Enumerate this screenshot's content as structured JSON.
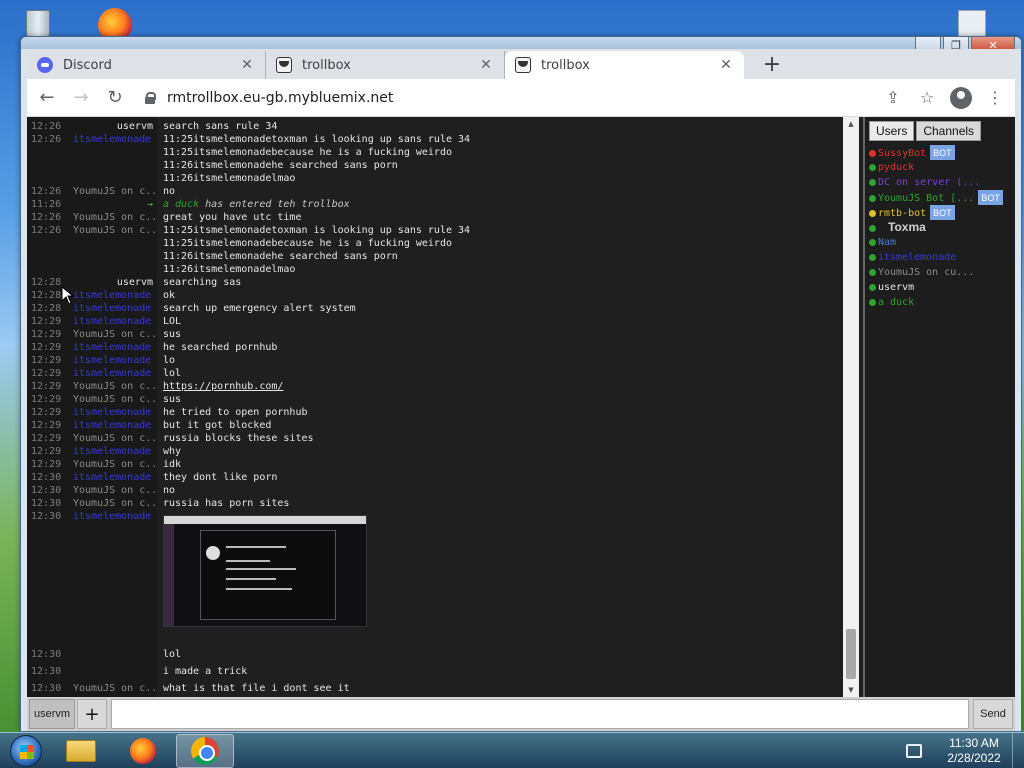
{
  "tabs": [
    {
      "title": "Discord",
      "icon": "discord-icon"
    },
    {
      "title": "trollbox",
      "icon": "troll-icon"
    },
    {
      "title": "trollbox",
      "icon": "troll-icon"
    }
  ],
  "url": "rmtrollbox.eu-gb.mybluemix.net",
  "chat": [
    {
      "time": "12:26",
      "nick": "uservm",
      "nick_class": "user",
      "text": "search sans rule 34"
    },
    {
      "time": "12:26",
      "nick": "itsmelemonade",
      "nick_class": "lemon",
      "text": "11:25itsmelemonadetoxman is looking up sans rule 34"
    },
    {
      "time": "",
      "nick": "",
      "nick_class": "",
      "text": "11:25itsmelemonadebecause he is a fucking weirdo"
    },
    {
      "time": "",
      "nick": "",
      "nick_class": "",
      "text": "11:26itsmelemonadehe searched sans porn"
    },
    {
      "time": "",
      "nick": "",
      "nick_class": "",
      "text": "11:26itsmelemonadelmao"
    },
    {
      "time": "12:26",
      "nick": "YoumuJS on c...",
      "nick_class": "youmu",
      "text": "no"
    },
    {
      "time": "11:26",
      "nick": "→",
      "nick_class": "arrow",
      "text": "",
      "system_who": "a duck",
      "system_text": " has entered teh trollbox"
    },
    {
      "time": "12:26",
      "nick": "YoumuJS on c...",
      "nick_class": "youmu",
      "text": "great you have utc time"
    },
    {
      "time": "12:26",
      "nick": "YoumuJS on c...",
      "nick_class": "youmu",
      "text": "11:25itsmelemonadetoxman is looking up sans rule 34"
    },
    {
      "time": "",
      "nick": "",
      "nick_class": "",
      "text": "11:25itsmelemonadebecause he is a fucking weirdo"
    },
    {
      "time": "",
      "nick": "",
      "nick_class": "",
      "text": "11:26itsmelemonadehe searched sans porn"
    },
    {
      "time": "",
      "nick": "",
      "nick_class": "",
      "text": "11:26itsmelemonadelmao"
    },
    {
      "time": "12:28",
      "nick": "uservm",
      "nick_class": "user",
      "text": "searching sas"
    },
    {
      "time": "12:28",
      "nick": "itsmelemonade",
      "nick_class": "lemon",
      "text": "ok"
    },
    {
      "time": "12:28",
      "nick": "itsmelemonade",
      "nick_class": "lemon",
      "text": "search up emergency alert system"
    },
    {
      "time": "12:29",
      "nick": "itsmelemonade",
      "nick_class": "lemon",
      "text": "LOL"
    },
    {
      "time": "12:29",
      "nick": "YoumuJS on c...",
      "nick_class": "youmu",
      "text": "sus"
    },
    {
      "time": "12:29",
      "nick": "itsmelemonade",
      "nick_class": "lemon",
      "text": "he searched pornhub"
    },
    {
      "time": "12:29",
      "nick": "itsmelemonade",
      "nick_class": "lemon",
      "text": "lo"
    },
    {
      "time": "12:29",
      "nick": "itsmelemonade",
      "nick_class": "lemon",
      "text": "lol"
    },
    {
      "time": "12:29",
      "nick": "YoumuJS on c...",
      "nick_class": "youmu",
      "text": "",
      "link": "https://pornhub.com/"
    },
    {
      "time": "12:29",
      "nick": "YoumuJS on c...",
      "nick_class": "youmu",
      "text": "sus"
    },
    {
      "time": "12:29",
      "nick": "itsmelemonade",
      "nick_class": "lemon",
      "text": "he tried to open pornhub"
    },
    {
      "time": "12:29",
      "nick": "itsmelemonade",
      "nick_class": "lemon",
      "text": "but it got blocked"
    },
    {
      "time": "12:29",
      "nick": "YoumuJS on c...",
      "nick_class": "youmu",
      "text": "russia blocks these sites"
    },
    {
      "time": "12:29",
      "nick": "itsmelemonade",
      "nick_class": "lemon",
      "text": "why"
    },
    {
      "time": "12:29",
      "nick": "YoumuJS on c...",
      "nick_class": "youmu",
      "text": "idk"
    },
    {
      "time": "12:30",
      "nick": "itsmelemonade",
      "nick_class": "lemon",
      "text": "they dont like porn"
    },
    {
      "time": "12:30",
      "nick": "YoumuJS on c...",
      "nick_class": "youmu",
      "text": "no"
    },
    {
      "time": "12:30",
      "nick": "YoumuJS on c...",
      "nick_class": "youmu",
      "text": "russia has porn sites"
    },
    {
      "time": "12:30",
      "nick": "itsmelemonade",
      "nick_class": "lemon",
      "text": ""
    }
  ],
  "chat_after_image": [
    {
      "time": "12:30",
      "nick": "",
      "nick_class": "lemon",
      "text": "lol"
    },
    {
      "time": "12:30",
      "nick": "",
      "nick_class": "lemon",
      "text": "i made a trick"
    },
    {
      "time": "12:30",
      "nick": "YoumuJS on c...",
      "nick_class": "youmu",
      "text": "what is that file i dont see it"
    }
  ],
  "sidebar": {
    "tabs": [
      "Users",
      "Channels"
    ],
    "users": [
      {
        "name": "SussyBot",
        "color": "#e03030",
        "dot": "#e03030",
        "bot": true,
        "prefix": "▀ "
      },
      {
        "name": "pyduck",
        "color": "#e03030",
        "dot": "#2fa32f",
        "bot": false
      },
      {
        "name": "DC on server (...",
        "color": "#7b3fd6",
        "dot": "#2fa32f",
        "bot": false
      },
      {
        "name": "YoumuJS Bot [...",
        "color": "#2fa32f",
        "dot": "#2fa32f",
        "bot": true
      },
      {
        "name": "rmtb-bot",
        "color": "#e0c030",
        "dot": "#e0c030",
        "bot": true
      },
      {
        "name": "Toxma",
        "color": "#d0d0d0",
        "dot": "#2fa32f",
        "bot": false,
        "big": true
      },
      {
        "name": "Nam",
        "color": "#4a7ad6",
        "dot": "#2fa32f",
        "bot": false
      },
      {
        "name": "itsmelemonade",
        "color": "#3939d6",
        "dot": "#2fa32f",
        "bot": false
      },
      {
        "name": "YoumuJS on cu...",
        "color": "#8b8b8b",
        "dot": "#2fa32f",
        "bot": false
      },
      {
        "name": "uservm",
        "color": "#e6e6e6",
        "dot": "#2fa32f",
        "bot": false
      },
      {
        "name": "a duck",
        "color": "#2fa32f",
        "dot": "#2fa32f",
        "bot": false
      }
    ],
    "bot_label": "BOT"
  },
  "inputbar": {
    "nick": "uservm",
    "plus": "+",
    "send": "Send"
  },
  "clock": {
    "time": "11:30 AM",
    "date": "2/28/2022"
  },
  "colors": {
    "chat_bg": "#1f1f1f",
    "lemon": "#3939d6",
    "youmu": "#8b8b8b",
    "system_green": "#2fa32f"
  }
}
